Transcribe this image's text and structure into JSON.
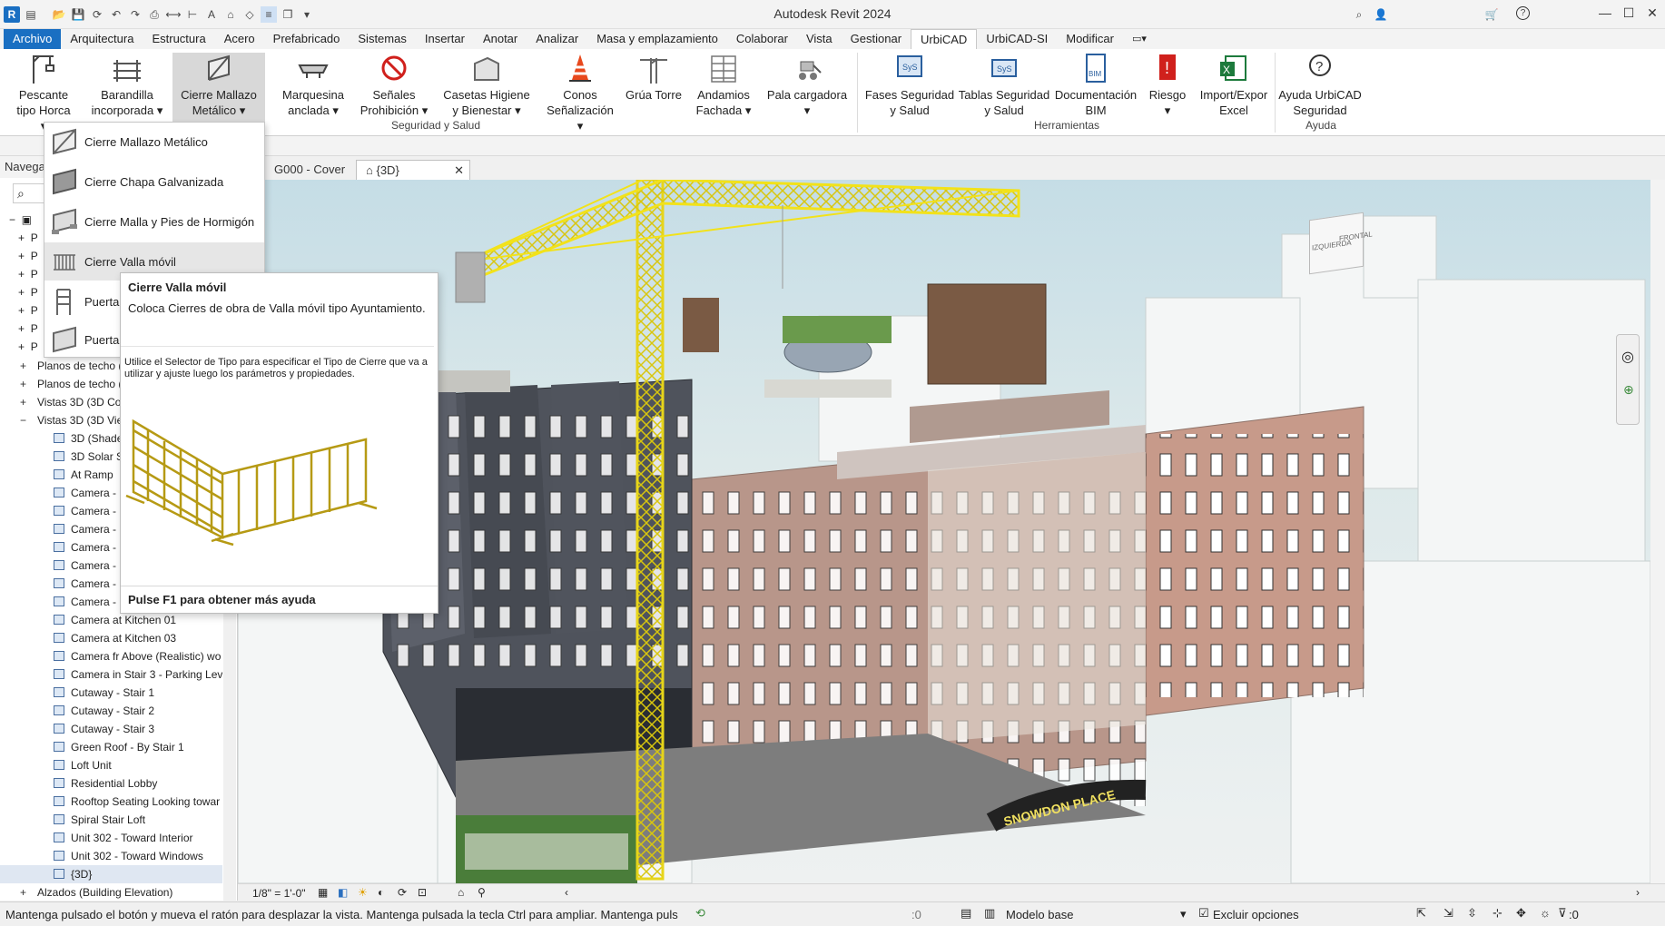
{
  "app": {
    "title": "Autodesk Revit 2024"
  },
  "menu": {
    "tabs": [
      "Archivo",
      "Arquitectura",
      "Estructura",
      "Acero",
      "Prefabricado",
      "Sistemas",
      "Insertar",
      "Anotar",
      "Analizar",
      "Masa y emplazamiento",
      "Colaborar",
      "Vista",
      "Gestionar",
      "UrbiCAD",
      "UrbiCAD-SI",
      "Modificar"
    ],
    "active": "UrbiCAD"
  },
  "ribbon": {
    "buttons": [
      {
        "label1": "Pescante",
        "label2": "tipo Horca"
      },
      {
        "label1": "Barandilla",
        "label2": "incorporada"
      },
      {
        "label1": "Cierre Mallazo",
        "label2": "Metálico"
      },
      {
        "label1": "Marquesina",
        "label2": "anclada"
      },
      {
        "label1": "Señales",
        "label2": "Prohibición"
      },
      {
        "label1": "Casetas Higiene",
        "label2": "y Bienestar"
      },
      {
        "label1": "Conos",
        "label2": "Señalización"
      },
      {
        "label1": "Grúa Torre",
        "label2": ""
      },
      {
        "label1": "Andamios",
        "label2": "Fachada"
      },
      {
        "label1": "Pala cargadora",
        "label2": ""
      },
      {
        "label1": "Fases Seguridad",
        "label2": "y Salud"
      },
      {
        "label1": "Tablas Seguridad",
        "label2": "y Salud"
      },
      {
        "label1": "Documentación",
        "label2": "BIM"
      },
      {
        "label1": "Riesgo",
        "label2": ""
      },
      {
        "label1": "Import/Expor",
        "label2": "Excel"
      },
      {
        "label1": "Ayuda UrbiCAD",
        "label2": "Seguridad"
      }
    ],
    "panels": [
      "Seguridad y Salud",
      "Herramientas",
      "Ayuda"
    ]
  },
  "dropdown": {
    "items": [
      "Cierre Mallazo  Metálico",
      "Cierre Chapa  Galvanizada",
      "Cierre Malla y  Pies de Hormigón",
      "Cierre Valla  móvil",
      "Puerta",
      "Puerta"
    ],
    "highlighted": 3
  },
  "tooltip": {
    "title": "Cierre Valla móvil",
    "description": "Coloca Cierres de obra de Valla móvil tipo Ayuntamiento.",
    "note": "Utilice el Selector de Tipo para especificar el Tipo de Cierre que va a utilizar y ajuste luego los parámetros y propiedades.",
    "help": "Pulse F1 para obtener más ayuda"
  },
  "browser": {
    "header": "Navega",
    "search_placeholder": "",
    "top_rows": [
      "P",
      "P",
      "P",
      "P",
      "P",
      "P",
      "P"
    ],
    "rows": [
      {
        "exp": "+",
        "label": "Planos de techo (",
        "sub": false
      },
      {
        "exp": "+",
        "label": "Planos de techo (",
        "sub": false
      },
      {
        "exp": "+",
        "label": "Vistas 3D (3D Co",
        "sub": false
      },
      {
        "exp": "−",
        "label": "Vistas 3D (3D Vie",
        "sub": false
      },
      {
        "label": "3D (Shade",
        "sub": true
      },
      {
        "label": "3D Solar S",
        "sub": true
      },
      {
        "label": "At Ramp",
        "sub": true
      },
      {
        "label": "Camera -",
        "sub": true
      },
      {
        "label": "Camera -",
        "sub": true
      },
      {
        "label": "Camera -",
        "sub": true
      },
      {
        "label": "Camera -",
        "sub": true
      },
      {
        "label": "Camera -",
        "sub": true
      },
      {
        "label": "Camera -",
        "sub": true
      },
      {
        "label": "Camera -",
        "sub": true
      },
      {
        "label": "Camera at Kitchen 01",
        "sub": true
      },
      {
        "label": "Camera at Kitchen 03",
        "sub": true
      },
      {
        "label": "Camera fr Above (Realistic) wo",
        "sub": true
      },
      {
        "label": "Camera in Stair 3 - Parking Leve",
        "sub": true
      },
      {
        "label": "Cutaway - Stair 1",
        "sub": true
      },
      {
        "label": "Cutaway - Stair 2",
        "sub": true
      },
      {
        "label": "Cutaway - Stair 3",
        "sub": true
      },
      {
        "label": "Green Roof - By Stair 1",
        "sub": true
      },
      {
        "label": "Loft Unit",
        "sub": true
      },
      {
        "label": "Residential Lobby",
        "sub": true
      },
      {
        "label": "Rooftop Seating Looking towar",
        "sub": true
      },
      {
        "label": "Spiral Stair Loft",
        "sub": true
      },
      {
        "label": "Unit 302 - Toward Interior",
        "sub": true
      },
      {
        "label": "Unit 302 - Toward Windows",
        "sub": true
      },
      {
        "label": "{3D}",
        "sub": true,
        "selected": true
      },
      {
        "exp": "+",
        "label": "Alzados (Building Elevation)",
        "sub": false
      }
    ]
  },
  "view_tabs": {
    "tab1": "G000 - Cover",
    "tab2": "{3D}"
  },
  "viewcube": {
    "left": "IZQUIERDA",
    "right": "FRONTAL"
  },
  "sign_text": "SNOWDON PLACE",
  "viewbar": {
    "scale": "1/8\" = 1'-0\""
  },
  "status": {
    "message": "Mantenga pulsado el botón y mueva el ratón para desplazar la vista. Mantenga pulsada la tecla Ctrl para ampliar. Mantenga puls",
    "sel_count": ":0",
    "model": "Modelo base",
    "exclude": "Excluir opciones",
    "filter_count": ":0"
  },
  "colors": {
    "accent": "#1a6fc2",
    "crane": "#f2e21a",
    "brick": "#b8968a",
    "panel_dark": "#4f535c"
  }
}
